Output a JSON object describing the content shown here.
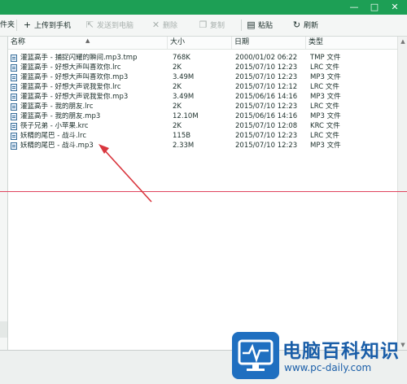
{
  "window": {
    "min_label": "—",
    "max_label": "□",
    "close_label": "✕"
  },
  "toolbar": {
    "cut_left": "件夹",
    "upload": "上传到手机",
    "send_to_pc": "发送到电脑",
    "delete": "删除",
    "copy": "复制",
    "paste": "粘贴",
    "refresh": "刷新"
  },
  "columns": {
    "name": "名称",
    "size": "大小",
    "date": "日期",
    "type": "类型"
  },
  "files": [
    {
      "name": "灌篮高手 - 捕捉闪耀的瞬间.mp3.tmp",
      "size": "768K",
      "date": "2000/01/02 06:22",
      "type": "TMP 文件"
    },
    {
      "name": "灌篮高手 - 好想大声叫喜欢你.lrc",
      "size": "2K",
      "date": "2015/07/10 12:23",
      "type": "LRC 文件"
    },
    {
      "name": "灌篮高手 - 好想大声叫喜欢你.mp3",
      "size": "3.49M",
      "date": "2015/07/10 12:23",
      "type": "MP3 文件"
    },
    {
      "name": "灌篮高手 - 好想大声说我爱你.lrc",
      "size": "2K",
      "date": "2015/07/10 12:12",
      "type": "LRC 文件"
    },
    {
      "name": "灌篮高手 - 好想大声说我爱你.mp3",
      "size": "3.49M",
      "date": "2015/06/16 14:16",
      "type": "MP3 文件"
    },
    {
      "name": "灌篮高手 - 我的朋友.lrc",
      "size": "2K",
      "date": "2015/07/10 12:23",
      "type": "LRC 文件"
    },
    {
      "name": "灌篮高手 - 我的朋友.mp3",
      "size": "12.10M",
      "date": "2015/06/16 14:16",
      "type": "MP3 文件"
    },
    {
      "name": "筷子兄弟 - 小苹果.krc",
      "size": "2K",
      "date": "2015/07/10 12:08",
      "type": "KRC 文件"
    },
    {
      "name": "妖精的尾巴 - 战斗.lrc",
      "size": "115B",
      "date": "2015/07/10 12:23",
      "type": "LRC 文件"
    },
    {
      "name": "妖精的尾巴 - 战斗.mp3",
      "size": "2.33M",
      "date": "2015/07/10 12:23",
      "type": "MP3 文件"
    }
  ],
  "watermark": {
    "name": "电脑百科知识",
    "url": "www.pc-daily.com"
  },
  "colors": {
    "titlebar": "#1d9f55",
    "annotation_arrow": "#d9363e",
    "logo_blue": "#1f6fc0"
  }
}
